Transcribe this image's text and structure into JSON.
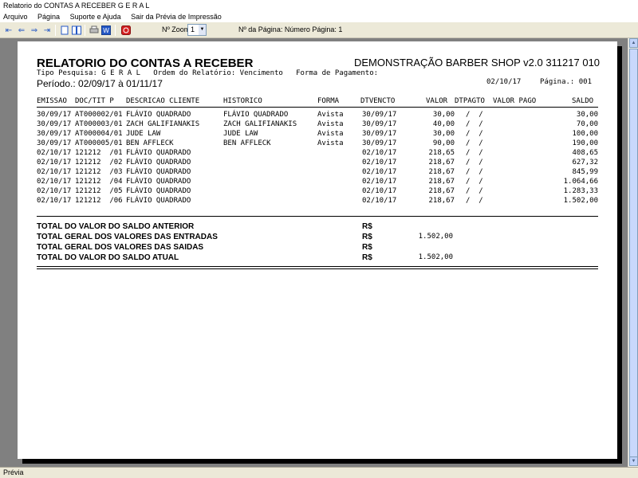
{
  "window": {
    "title": "Relatorio do CONTAS A RECEBER G E R A L"
  },
  "menu": {
    "items": [
      "Arquivo",
      "Página",
      "Suporte e Ajuda",
      "Sair da Prévia de Impressão"
    ]
  },
  "toolbar": {
    "zoom_label": "Nº Zoom",
    "zoom_value": "1",
    "page_label": "Nº da Página: Número Página: 1",
    "icons": [
      "first-page-icon",
      "prev-page-icon",
      "next-page-icon",
      "last-page-icon",
      "single-page-icon",
      "two-pages-icon",
      "print-icon",
      "word-export-icon",
      "pdf-export-icon"
    ]
  },
  "status": {
    "text": "Prévia"
  },
  "report": {
    "title": "RELATORIO DO CONTAS A RECEBER",
    "company": "DEMONSTRAÇÃO BARBER SHOP v2.0 311217 010",
    "subtitle": "Tipo Pesquisa: G E R A L   Ordem do Relatório: Vencimento   Forma de Pagamento:",
    "period": "Período.: 02/09/17 à 01/11/17",
    "date": "02/10/17",
    "page": "Página.: 001",
    "columns": {
      "emissao": "EMISSAO",
      "doc": "DOC/TIT P",
      "cliente": "DESCRICAO CLIENTE",
      "historico": "HISTORICO",
      "forma": "FORMA",
      "dtvencto": "DTVENCTO",
      "valor": "VALOR",
      "dtpagto": "DTPAGTO",
      "valorpago": "VALOR PAGO",
      "saldo": "SALDO"
    },
    "rows": [
      {
        "emissao": "30/09/17",
        "doc": "AT000002/01",
        "cliente": "FLÁVIO QUADRADO",
        "historico": "FLÁVIO QUADRADO",
        "forma": "Avista",
        "dtvencto": "30/09/17",
        "valor": "30,00",
        "dtpagto": "/  /",
        "saldo": "30,00"
      },
      {
        "emissao": "30/09/17",
        "doc": "AT000003/01",
        "cliente": "ZACH GALIFIANAKIS",
        "historico": "ZACH GALIFIANAKIS",
        "forma": "Avista",
        "dtvencto": "30/09/17",
        "valor": "40,00",
        "dtpagto": "/  /",
        "saldo": "70,00"
      },
      {
        "emissao": "30/09/17",
        "doc": "AT000004/01",
        "cliente": "JUDE LAW",
        "historico": "JUDE LAW",
        "forma": "Avista",
        "dtvencto": "30/09/17",
        "valor": "30,00",
        "dtpagto": "/  /",
        "saldo": "100,00"
      },
      {
        "emissao": "30/09/17",
        "doc": "AT000005/01",
        "cliente": "BEN AFFLECK",
        "historico": "BEN AFFLECK",
        "forma": "Avista",
        "dtvencto": "30/09/17",
        "valor": "90,00",
        "dtpagto": "/  /",
        "saldo": "190,00"
      },
      {
        "emissao": "02/10/17",
        "doc": "121212  /01",
        "cliente": "FLÁVIO QUADRADO",
        "historico": "",
        "forma": "",
        "dtvencto": "02/10/17",
        "valor": "218,65",
        "dtpagto": "/  /",
        "saldo": "408,65"
      },
      {
        "emissao": "02/10/17",
        "doc": "121212  /02",
        "cliente": "FLÁVIO QUADRADO",
        "historico": "",
        "forma": "",
        "dtvencto": "02/10/17",
        "valor": "218,67",
        "dtpagto": "/  /",
        "saldo": "627,32"
      },
      {
        "emissao": "02/10/17",
        "doc": "121212  /03",
        "cliente": "FLÁVIO QUADRADO",
        "historico": "",
        "forma": "",
        "dtvencto": "02/10/17",
        "valor": "218,67",
        "dtpagto": "/  /",
        "saldo": "845,99"
      },
      {
        "emissao": "02/10/17",
        "doc": "121212  /04",
        "cliente": "FLÁVIO QUADRADO",
        "historico": "",
        "forma": "",
        "dtvencto": "02/10/17",
        "valor": "218,67",
        "dtpagto": "/  /",
        "saldo": "1.064,66"
      },
      {
        "emissao": "02/10/17",
        "doc": "121212  /05",
        "cliente": "FLÁVIO QUADRADO",
        "historico": "",
        "forma": "",
        "dtvencto": "02/10/17",
        "valor": "218,67",
        "dtpagto": "/  /",
        "saldo": "1.283,33"
      },
      {
        "emissao": "02/10/17",
        "doc": "121212  /06",
        "cliente": "FLÁVIO QUADRADO",
        "historico": "",
        "forma": "",
        "dtvencto": "02/10/17",
        "valor": "218,67",
        "dtpagto": "/  /",
        "saldo": "1.502,00"
      }
    ],
    "totals": [
      {
        "label": "TOTAL DO VALOR DO SALDO ANTERIOR",
        "currency": "R$",
        "value": ""
      },
      {
        "label": "TOTAL GERAL DOS VALORES DAS ENTRADAS",
        "currency": "R$",
        "value": "1.502,00"
      },
      {
        "label": "TOTAL GERAL DOS VALORES DAS SAIDAS",
        "currency": "R$",
        "value": ""
      },
      {
        "label": "TOTAL DO VALOR DO SALDO ATUAL",
        "currency": "R$",
        "value": "1.502,00"
      }
    ]
  }
}
